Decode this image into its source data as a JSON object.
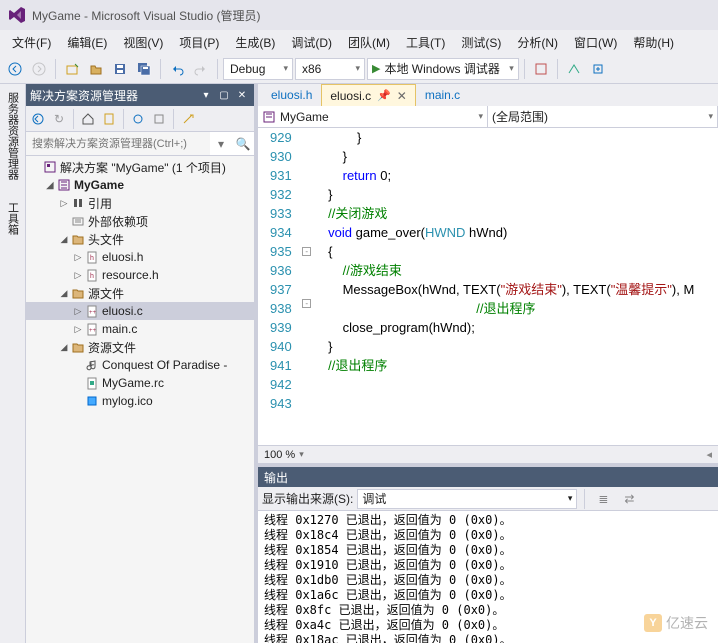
{
  "window": {
    "title": "MyGame - Microsoft Visual Studio  (管理员)"
  },
  "menu": [
    "文件(F)",
    "编辑(E)",
    "视图(V)",
    "项目(P)",
    "生成(B)",
    "调试(D)",
    "团队(M)",
    "工具(T)",
    "测试(S)",
    "分析(N)",
    "窗口(W)",
    "帮助(H)"
  ],
  "toolbar": {
    "config": "Debug",
    "platform": "x86",
    "run_label": "本地 Windows 调试器"
  },
  "left_rail": [
    "服务器资源管理器",
    "工具箱"
  ],
  "solution_explorer": {
    "title": "解决方案资源管理器",
    "search_placeholder": "搜索解决方案资源管理器(Ctrl+;)",
    "root": "解决方案 \"MyGame\" (1 个项目)",
    "project": "MyGame",
    "nodes": {
      "references": "引用",
      "external": "外部依赖项",
      "headers": "头文件",
      "header_items": [
        "eluosi.h",
        "resource.h"
      ],
      "sources": "源文件",
      "source_items": [
        "eluosi.c",
        "main.c"
      ],
      "resources": "资源文件",
      "resource_items": [
        "Conquest Of Paradise - ",
        "MyGame.rc",
        "mylog.ico"
      ]
    }
  },
  "editor": {
    "tabs": [
      "eluosi.h",
      "eluosi.c",
      "main.c"
    ],
    "active_tab": 1,
    "nav_left": "MyGame",
    "nav_right": "(全局范围)",
    "zoom": "100 %",
    "lines": [
      {
        "n": 929,
        "outline": "",
        "code": "            }"
      },
      {
        "n": 930,
        "outline": "",
        "code": "        }"
      },
      {
        "n": 931,
        "outline": "",
        "code": "        return 0;",
        "kw": [
          "return"
        ],
        "num": [
          "0"
        ]
      },
      {
        "n": 932,
        "outline": "",
        "code": "    }"
      },
      {
        "n": 933,
        "outline": "",
        "code": ""
      },
      {
        "n": 934,
        "outline": "",
        "code": "    //关闭游戏",
        "cmt": true
      },
      {
        "n": 935,
        "outline": "box",
        "code": "    void game_over(HWND hWnd)",
        "kw": [
          "void"
        ],
        "type": [
          "HWND"
        ]
      },
      {
        "n": 936,
        "outline": "",
        "code": "    {"
      },
      {
        "n": 937,
        "outline": "",
        "code": "        //游戏结束",
        "cmt": true
      },
      {
        "n": 938,
        "outline": "box",
        "code": "        MessageBox(hWnd, TEXT(\"游戏结束\"), TEXT(\"温馨提示\"), M",
        "str": [
          "\"游戏结束\"",
          "\"温馨提示\""
        ]
      },
      {
        "n": 939,
        "outline": "",
        "code": "                                             //退出程序",
        "cmt": true
      },
      {
        "n": 940,
        "outline": "",
        "code": "        close_program(hWnd);"
      },
      {
        "n": 941,
        "outline": "",
        "code": "    }"
      },
      {
        "n": 942,
        "outline": "",
        "code": ""
      },
      {
        "n": 943,
        "outline": "",
        "code": "    //退出程序",
        "cmt": true
      }
    ]
  },
  "output": {
    "title": "输出",
    "source_label": "显示输出来源(S):",
    "source_value": "调试",
    "lines": [
      "线程 0x1270 已退出，返回值为 0 (0x0)。",
      "线程 0x18c4 已退出，返回值为 0 (0x0)。",
      "线程 0x1854 已退出，返回值为 0 (0x0)。",
      "线程 0x1910 已退出，返回值为 0 (0x0)。",
      "线程 0x1db0 已退出，返回值为 0 (0x0)。",
      "线程 0x1a6c 已退出，返回值为 0 (0x0)。",
      "线程 0x8fc 已退出，返回值为 0 (0x0)。",
      "线程 0xa4c 已退出，返回值为 0 (0x0)。",
      "线程 0x18ac 已退出，返回值为 0 (0x0)。"
    ]
  },
  "watermark": "亿速云"
}
